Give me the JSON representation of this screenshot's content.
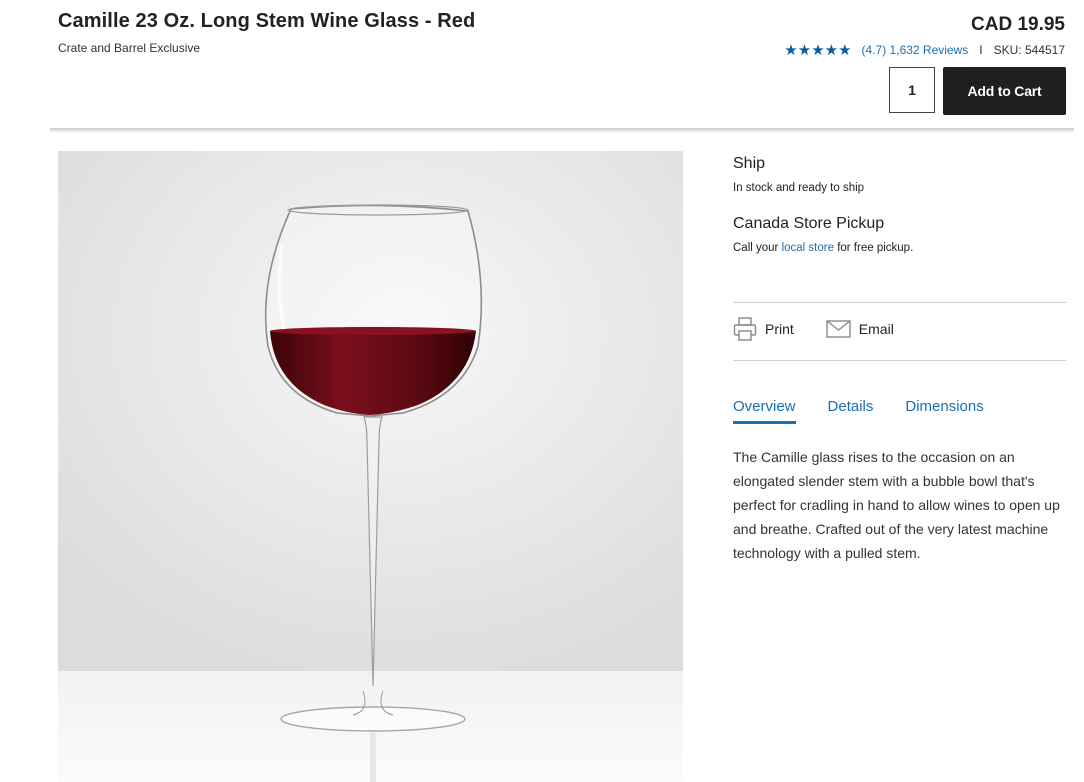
{
  "product": {
    "title": "Camille 23 Oz. Long Stem Wine Glass - Red",
    "brand_note": "Crate and Barrel Exclusive",
    "price": "CAD 19.95",
    "rating_value": 4.7,
    "rating_text": "(4.7) 1,632 Reviews",
    "separator": "I",
    "sku": "SKU: 544517",
    "quantity": "1",
    "add_to_cart_label": "Add to Cart"
  },
  "icons": {
    "star": "star-icon",
    "print": "printer-icon",
    "email": "envelope-icon"
  },
  "fulfillment": {
    "ship_title": "Ship",
    "ship_text": "In stock and ready to ship",
    "pickup_title": "Canada Store Pickup",
    "pickup_prefix": "Call your ",
    "pickup_link": "local store",
    "pickup_suffix": " for free pickup."
  },
  "share": {
    "print_label": "Print",
    "email_label": "Email"
  },
  "tabs": [
    {
      "label": "Overview",
      "active": true
    },
    {
      "label": "Details",
      "active": false
    },
    {
      "label": "Dimensions",
      "active": false
    }
  ],
  "overview_text": "The Camille glass rises to the occasion on an elongated slender stem with a bubble bowl that's perfect for cradling in hand to allow wines to open up and breathe. Crafted out of the very latest machine technology with a pulled stem.",
  "colors": {
    "accent_blue": "#1a6fb5",
    "star_blue": "#0a5e9c",
    "button_dark": "#1f1f1f",
    "wine_red": "#5e0a13"
  }
}
